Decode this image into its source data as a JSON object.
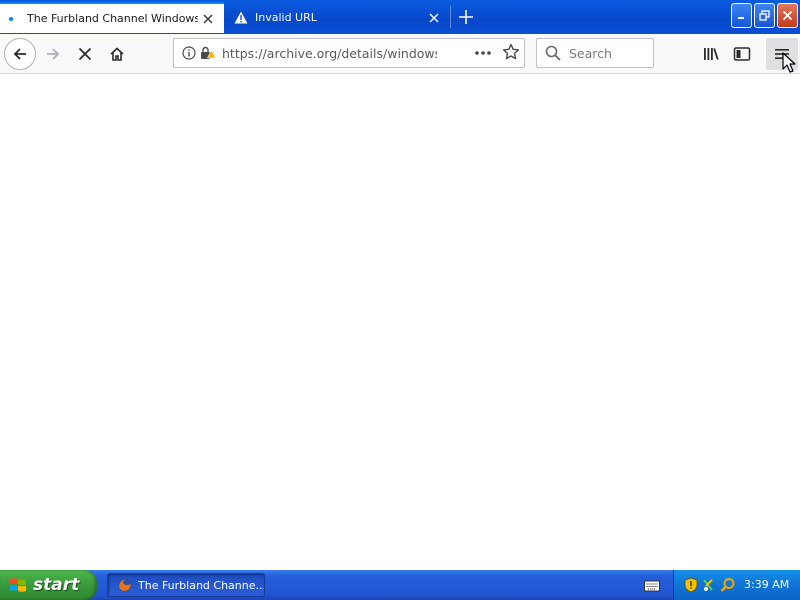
{
  "tabs": [
    {
      "title": "The Furbland Channel Windows Bo",
      "active": true
    },
    {
      "title": "Invalid URL",
      "active": false
    }
  ],
  "navbar": {
    "url": "https://archive.org/details/windowsb",
    "search_placeholder": "Search"
  },
  "taskbar": {
    "start_label": "start",
    "item_label": "The Furbland Channe...",
    "clock": "3:39 AM"
  },
  "colors": {
    "accent": "#0a84ff",
    "xp_blue": "#245edb",
    "start_green": "#3a9a3a"
  }
}
